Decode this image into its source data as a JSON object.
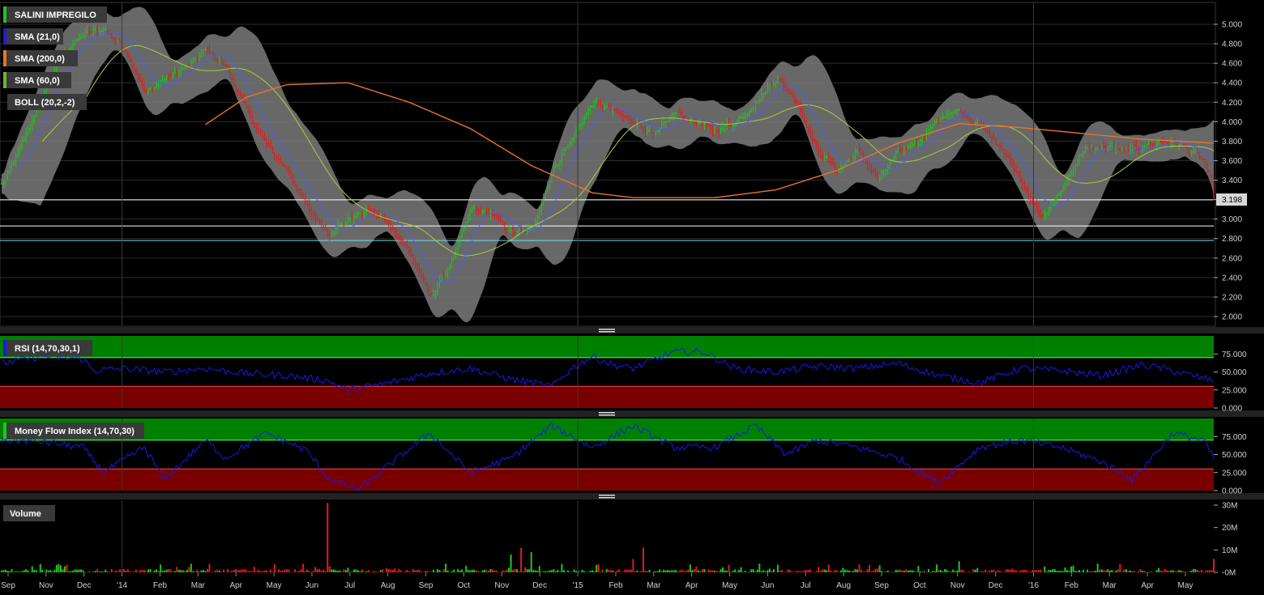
{
  "colors": {
    "background": "#000000",
    "grid": "#2c2c2c",
    "bollinger_band": "#7a7a7a",
    "sma21": "#4a5cff",
    "sma200": "#e8742b",
    "sma60": "#a6d03a",
    "bull": "#22c322",
    "bear": "#e11b1b",
    "overbought_zone": "#008000",
    "oversold_zone": "#7a0000",
    "oscillator_line": "#1a1ae6",
    "price_tag": "#d8d8d8"
  },
  "legend": {
    "title": "SALINI IMPREGILO",
    "sma21": "SMA (21,0)",
    "sma200": "SMA (200,0)",
    "sma60": "SMA (60,0)",
    "boll": "BOLL (20,2,-2)",
    "rsi": "RSI (14,70,30,1)",
    "mfi": "Money Flow Index (14,70,30)",
    "volume": "Volume"
  },
  "chart_data": [
    {
      "type": "candlestick",
      "title": "SALINI IMPREGILO",
      "ylim": [
        2.0,
        5.0
      ],
      "y_ticks": [
        "5.000",
        "4.800",
        "4.600",
        "4.400",
        "4.200",
        "4.000",
        "3.800",
        "3.600",
        "3.400",
        "3.200",
        "3.000",
        "2.800",
        "2.600",
        "2.400",
        "2.200",
        "2.000"
      ],
      "last_price_label": "3.198",
      "horizontal_lines": [
        3.198,
        2.93,
        2.78
      ],
      "price_path": [
        {
          "x": 0,
          "y": 3.35
        },
        {
          "x": 10,
          "y": 3.8
        },
        {
          "x": 20,
          "y": 4.3
        },
        {
          "x": 30,
          "y": 4.7
        },
        {
          "x": 40,
          "y": 4.9
        },
        {
          "x": 50,
          "y": 4.95
        },
        {
          "x": 60,
          "y": 4.75
        },
        {
          "x": 70,
          "y": 4.3
        },
        {
          "x": 80,
          "y": 4.45
        },
        {
          "x": 90,
          "y": 4.55
        },
        {
          "x": 100,
          "y": 4.75
        },
        {
          "x": 110,
          "y": 4.55
        },
        {
          "x": 120,
          "y": 4.1
        },
        {
          "x": 130,
          "y": 3.75
        },
        {
          "x": 140,
          "y": 3.5
        },
        {
          "x": 150,
          "y": 3.1
        },
        {
          "x": 160,
          "y": 2.85
        },
        {
          "x": 170,
          "y": 3.0
        },
        {
          "x": 180,
          "y": 3.1
        },
        {
          "x": 190,
          "y": 2.95
        },
        {
          "x": 200,
          "y": 2.65
        },
        {
          "x": 210,
          "y": 2.2
        },
        {
          "x": 220,
          "y": 2.55
        },
        {
          "x": 230,
          "y": 3.1
        },
        {
          "x": 240,
          "y": 3.05
        },
        {
          "x": 250,
          "y": 2.85
        },
        {
          "x": 260,
          "y": 2.9
        },
        {
          "x": 270,
          "y": 3.5
        },
        {
          "x": 280,
          "y": 3.85
        },
        {
          "x": 290,
          "y": 4.2
        },
        {
          "x": 300,
          "y": 4.1
        },
        {
          "x": 310,
          "y": 4.0
        },
        {
          "x": 320,
          "y": 3.85
        },
        {
          "x": 330,
          "y": 4.1
        },
        {
          "x": 340,
          "y": 4.0
        },
        {
          "x": 350,
          "y": 3.9
        },
        {
          "x": 360,
          "y": 4.0
        },
        {
          "x": 370,
          "y": 4.2
        },
        {
          "x": 380,
          "y": 4.45
        },
        {
          "x": 390,
          "y": 4.2
        },
        {
          "x": 400,
          "y": 3.7
        },
        {
          "x": 410,
          "y": 3.5
        },
        {
          "x": 420,
          "y": 3.7
        },
        {
          "x": 430,
          "y": 3.4
        },
        {
          "x": 440,
          "y": 3.7
        },
        {
          "x": 450,
          "y": 3.8
        },
        {
          "x": 460,
          "y": 4.05
        },
        {
          "x": 470,
          "y": 4.1
        },
        {
          "x": 480,
          "y": 3.95
        },
        {
          "x": 490,
          "y": 3.75
        },
        {
          "x": 500,
          "y": 3.4
        },
        {
          "x": 510,
          "y": 3.0
        },
        {
          "x": 520,
          "y": 3.3
        },
        {
          "x": 530,
          "y": 3.7
        },
        {
          "x": 540,
          "y": 3.75
        },
        {
          "x": 550,
          "y": 3.7
        },
        {
          "x": 560,
          "y": 3.75
        },
        {
          "x": 570,
          "y": 3.8
        },
        {
          "x": 580,
          "y": 3.75
        },
        {
          "x": 590,
          "y": 3.6
        },
        {
          "x": 595,
          "y": 3.2
        }
      ],
      "sma200_path": [
        {
          "x": 100,
          "y": 3.97
        },
        {
          "x": 120,
          "y": 4.25
        },
        {
          "x": 140,
          "y": 4.38
        },
        {
          "x": 170,
          "y": 4.4
        },
        {
          "x": 200,
          "y": 4.2
        },
        {
          "x": 230,
          "y": 3.93
        },
        {
          "x": 260,
          "y": 3.55
        },
        {
          "x": 290,
          "y": 3.27
        },
        {
          "x": 310,
          "y": 3.22
        },
        {
          "x": 350,
          "y": 3.22
        },
        {
          "x": 380,
          "y": 3.3
        },
        {
          "x": 410,
          "y": 3.5
        },
        {
          "x": 440,
          "y": 3.78
        },
        {
          "x": 470,
          "y": 3.98
        },
        {
          "x": 500,
          "y": 3.94
        },
        {
          "x": 530,
          "y": 3.88
        },
        {
          "x": 560,
          "y": 3.82
        },
        {
          "x": 595,
          "y": 3.78
        }
      ],
      "series": [
        {
          "name": "SMA (21,0)",
          "smooth_window": 14
        },
        {
          "name": "SMA (200,0)",
          "path_key": "sma200_path"
        },
        {
          "name": "SMA (60,0)",
          "smooth_window": 42
        },
        {
          "name": "BOLL (20,2,-2)",
          "band_width": 0.18
        }
      ],
      "x_ticks": [
        "Sep",
        "Nov",
        "Dec",
        "'14",
        "Feb",
        "Mar",
        "Apr",
        "May",
        "Jun",
        "Jul",
        "Aug",
        "Sep",
        "Oct",
        "Nov",
        "Dec",
        "'15",
        "Feb",
        "Mar",
        "Apr",
        "May",
        "Jun",
        "Jul",
        "Aug",
        "Sep",
        "Oct",
        "Nov",
        "Dec",
        "'16",
        "Feb",
        "Mar",
        "Apr",
        "May"
      ]
    },
    {
      "type": "line",
      "name": "RSI (14,70,30,1)",
      "ylim": [
        0,
        100
      ],
      "y_ticks": [
        "75.000",
        "50.000",
        "25.000",
        "0.000"
      ],
      "overbought": 70,
      "oversold": 30,
      "path": [
        {
          "x": 0,
          "y": 62
        },
        {
          "x": 20,
          "y": 72
        },
        {
          "x": 40,
          "y": 68
        },
        {
          "x": 45,
          "y": 52
        },
        {
          "x": 60,
          "y": 55
        },
        {
          "x": 80,
          "y": 50
        },
        {
          "x": 100,
          "y": 55
        },
        {
          "x": 120,
          "y": 48
        },
        {
          "x": 140,
          "y": 45
        },
        {
          "x": 160,
          "y": 38
        },
        {
          "x": 170,
          "y": 25
        },
        {
          "x": 190,
          "y": 35
        },
        {
          "x": 210,
          "y": 48
        },
        {
          "x": 230,
          "y": 55
        },
        {
          "x": 250,
          "y": 40
        },
        {
          "x": 270,
          "y": 30
        },
        {
          "x": 280,
          "y": 55
        },
        {
          "x": 290,
          "y": 72
        },
        {
          "x": 300,
          "y": 60
        },
        {
          "x": 310,
          "y": 55
        },
        {
          "x": 330,
          "y": 78
        },
        {
          "x": 345,
          "y": 78
        },
        {
          "x": 360,
          "y": 55
        },
        {
          "x": 380,
          "y": 50
        },
        {
          "x": 400,
          "y": 58
        },
        {
          "x": 420,
          "y": 55
        },
        {
          "x": 440,
          "y": 62
        },
        {
          "x": 460,
          "y": 45
        },
        {
          "x": 480,
          "y": 35
        },
        {
          "x": 500,
          "y": 55
        },
        {
          "x": 520,
          "y": 52
        },
        {
          "x": 540,
          "y": 45
        },
        {
          "x": 560,
          "y": 60
        },
        {
          "x": 570,
          "y": 55
        },
        {
          "x": 580,
          "y": 48
        },
        {
          "x": 595,
          "y": 38
        }
      ]
    },
    {
      "type": "line",
      "name": "Money Flow Index (14,70,30)",
      "ylim": [
        0,
        100
      ],
      "y_ticks": [
        "75.000",
        "50.000",
        "25.000",
        "0.000"
      ],
      "overbought": 70,
      "oversold": 30,
      "path": [
        {
          "x": 0,
          "y": 70
        },
        {
          "x": 20,
          "y": 68
        },
        {
          "x": 40,
          "y": 60
        },
        {
          "x": 50,
          "y": 25
        },
        {
          "x": 70,
          "y": 60
        },
        {
          "x": 80,
          "y": 15
        },
        {
          "x": 100,
          "y": 70
        },
        {
          "x": 110,
          "y": 45
        },
        {
          "x": 130,
          "y": 80
        },
        {
          "x": 150,
          "y": 55
        },
        {
          "x": 160,
          "y": 18
        },
        {
          "x": 175,
          "y": 0
        },
        {
          "x": 190,
          "y": 35
        },
        {
          "x": 210,
          "y": 80
        },
        {
          "x": 230,
          "y": 25
        },
        {
          "x": 250,
          "y": 45
        },
        {
          "x": 270,
          "y": 90
        },
        {
          "x": 290,
          "y": 60
        },
        {
          "x": 310,
          "y": 90
        },
        {
          "x": 330,
          "y": 60
        },
        {
          "x": 350,
          "y": 60
        },
        {
          "x": 370,
          "y": 90
        },
        {
          "x": 385,
          "y": 50
        },
        {
          "x": 400,
          "y": 70
        },
        {
          "x": 420,
          "y": 60
        },
        {
          "x": 440,
          "y": 45
        },
        {
          "x": 460,
          "y": 10
        },
        {
          "x": 480,
          "y": 60
        },
        {
          "x": 500,
          "y": 70
        },
        {
          "x": 520,
          "y": 60
        },
        {
          "x": 540,
          "y": 40
        },
        {
          "x": 555,
          "y": 15
        },
        {
          "x": 575,
          "y": 80
        },
        {
          "x": 590,
          "y": 70
        },
        {
          "x": 595,
          "y": 45
        }
      ]
    },
    {
      "type": "bar",
      "name": "Volume",
      "ylim": [
        0,
        30000000
      ],
      "y_ticks": [
        "30M",
        "20M",
        "10M",
        "-0M"
      ],
      "spikes": [
        {
          "x": 160,
          "y": 31000000
        },
        {
          "x": 250,
          "y": 8000000
        },
        {
          "x": 255,
          "y": 11000000
        },
        {
          "x": 260,
          "y": 9000000
        },
        {
          "x": 310,
          "y": 6000000
        },
        {
          "x": 315,
          "y": 11000000
        },
        {
          "x": 470,
          "y": 5000000
        },
        {
          "x": 595,
          "y": 6000000
        }
      ]
    }
  ]
}
